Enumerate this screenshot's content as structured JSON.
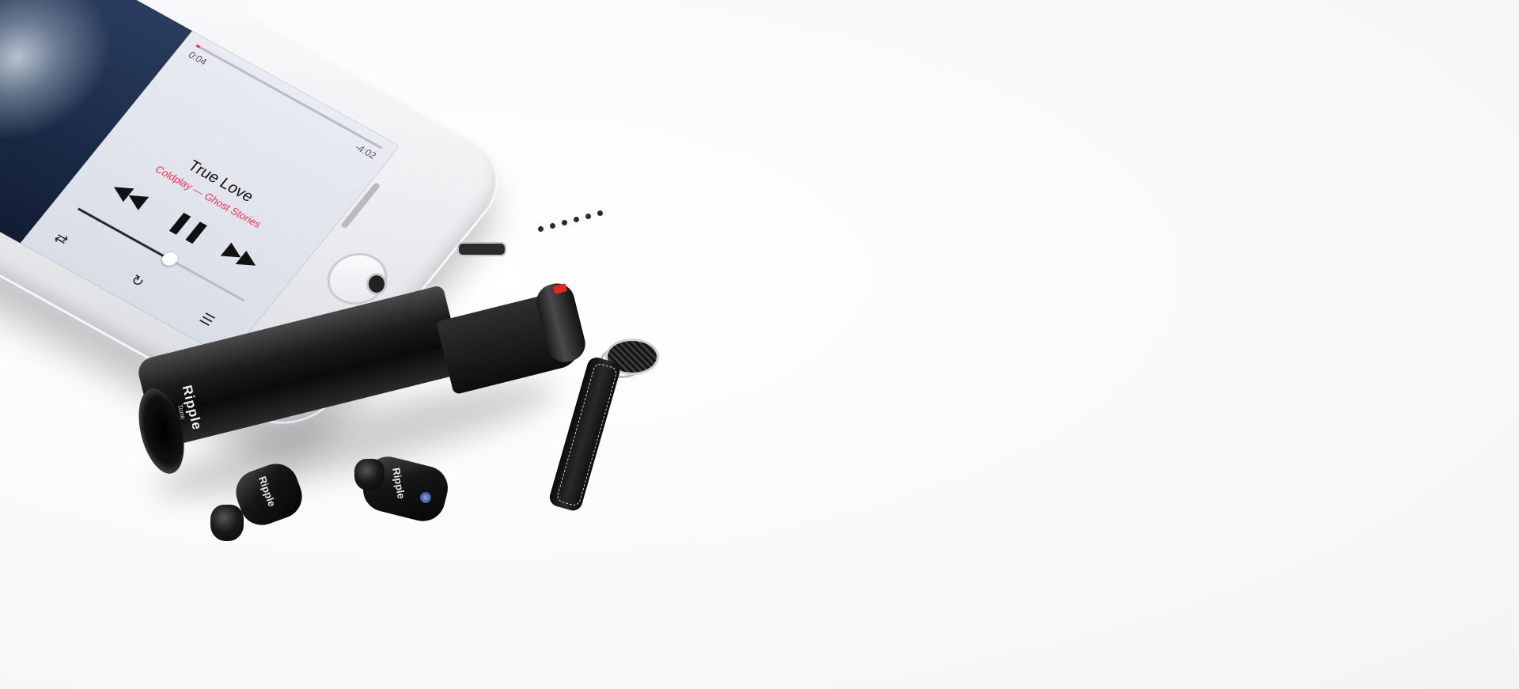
{
  "player": {
    "song_title": "True Love",
    "artist_album": "Coldplay — Ghost Stories",
    "time_elapsed": "0:04",
    "time_remaining": "-4:02",
    "progress_fraction": 0.02,
    "volume_fraction": 0.55,
    "icons": {
      "rewind": "rewind-icon",
      "pause": "pause-icon",
      "fast_forward": "fast-forward-icon",
      "airplay": "airplay-icon",
      "more": "more-icon",
      "queue": "queue-list-icon",
      "repeat": "repeat-icon",
      "shuffle": "shuffle-icon",
      "volume_low": "volume-low-icon"
    }
  },
  "case": {
    "brand": "Ripple",
    "sub": "Tone"
  },
  "earbuds": {
    "left_brand": "Ripple",
    "right_brand": "Ripple",
    "sub": "Tone"
  },
  "colors": {
    "accent": "#ff2d55",
    "case_light": "#e42525",
    "bud_button": "#1d2e7a"
  }
}
